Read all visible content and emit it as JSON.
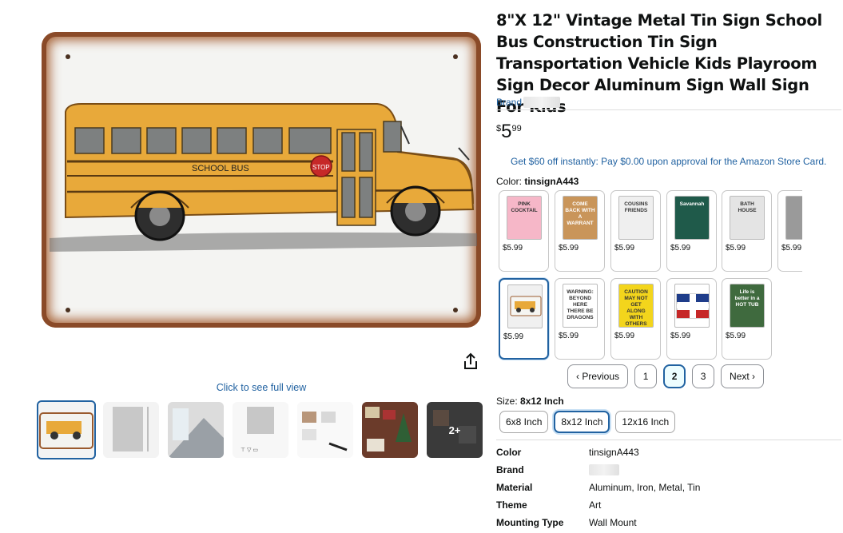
{
  "product": {
    "title": "8\"X 12\" Vintage Metal Tin Sign School Bus Construction Tin Sign Transportation Vehicle Kids Playroom Sign Decor Aluminum Sign Wall Sign For Kids",
    "brand_prefix": "Brand",
    "price": {
      "symbol": "$",
      "whole": "5",
      "fraction": "99"
    },
    "promo": "Get $60 off instantly: Pay $0.00 upon approval for the Amazon Store Card."
  },
  "gallery": {
    "full_view_link": "Click to see full view",
    "more_label": "2+",
    "bus_lettering": "SCHOOL BUS",
    "stop_lettering": "STOP"
  },
  "color": {
    "label": "Color: ",
    "selected": "tinsignA443",
    "swatches": [
      {
        "price": "$5.99",
        "bg": "#f6b7c8",
        "caption": "PINK COCKTAIL"
      },
      {
        "price": "$5.99",
        "bg": "#c9955a",
        "caption": "COME BACK WITH A WARRANT"
      },
      {
        "price": "$5.99",
        "bg": "#efefef",
        "caption": "COUSINS FRIENDS"
      },
      {
        "price": "$5.99",
        "bg": "#1f5a4a",
        "caption": "Savannah"
      },
      {
        "price": "$5.99",
        "bg": "#e4e4e4",
        "caption": "BATH HOUSE"
      },
      {
        "price": "$5.99",
        "bg": "#9a9a9a",
        "caption": ""
      },
      {
        "price": "$5.99",
        "bg": "#f0f0f0",
        "caption": ""
      },
      {
        "price": "$5.99",
        "bg": "#ffffff",
        "caption": "WARNING: BEYOND HERE THERE BE DRAGONS"
      },
      {
        "price": "$5.99",
        "bg": "#f3d51c",
        "caption": "CAUTION MAY NOT GET ALONG WITH OTHERS"
      },
      {
        "price": "$5.99",
        "bg": "#ffffff",
        "caption": ""
      },
      {
        "price": "$5.99",
        "bg": "#3f6a3e",
        "caption": "Life is better in a HOT TUB"
      }
    ]
  },
  "pagination": {
    "previous": "‹ Previous",
    "pages": [
      "1",
      "2",
      "3"
    ],
    "current": "2",
    "next": "Next ›"
  },
  "size": {
    "label": "Size: ",
    "selected": "8x12 Inch",
    "options": [
      "6x8 Inch",
      "8x12 Inch",
      "12x16 Inch"
    ]
  },
  "specs": [
    {
      "key": "Color",
      "value": "tinsignA443"
    },
    {
      "key": "Brand",
      "value": ""
    },
    {
      "key": "Material",
      "value": "Aluminum, Iron, Metal, Tin"
    },
    {
      "key": "Theme",
      "value": "Art"
    },
    {
      "key": "Mounting Type",
      "value": "Wall Mount"
    }
  ],
  "colors": {
    "link": "#2162a1",
    "selected_border": "#2162a1",
    "bus_yellow": "#e8a93a"
  }
}
